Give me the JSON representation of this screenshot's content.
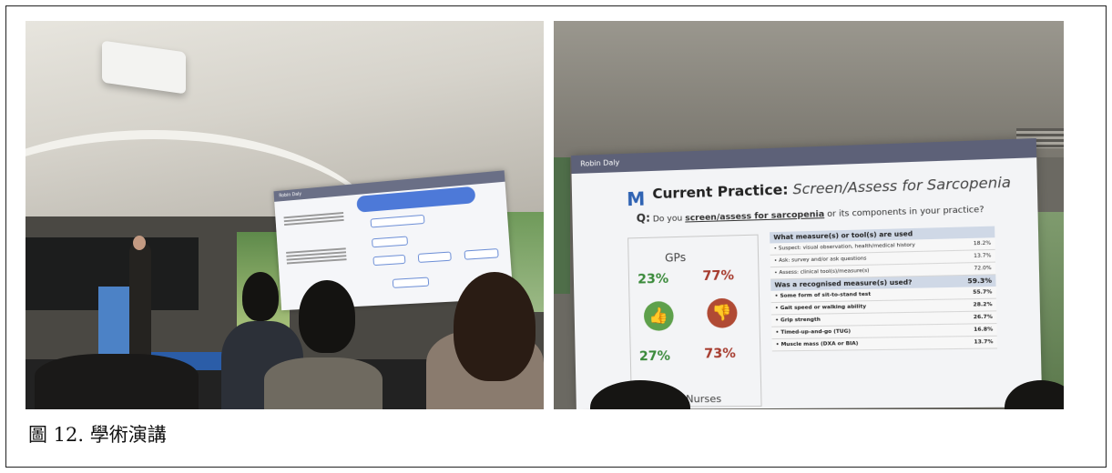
{
  "photo1": {
    "slide_author": "Robin Daly"
  },
  "photo2": {
    "slide": {
      "author": "Robin Daly",
      "logo_letter": "M",
      "title_bold": "Current Practice:",
      "title_italic": "Screen/Assess for Sarcopenia",
      "question_prefix": "Q:",
      "question_start": "Do you",
      "question_underlined": "screen/assess for sarcopenia",
      "question_end": "or its components in your practice?",
      "group_top": "GPs",
      "group_top_yes": "23%",
      "group_top_no": "77%",
      "group_bottom_yes": "27%",
      "group_bottom_no": "73%",
      "group_bottom": "Practice Nurses",
      "table": {
        "section1_header": "What measure(s) or tool(s) are used",
        "section1_rows": [
          {
            "label": "Suspect: visual observation, health/medical history",
            "value": "18.2%"
          },
          {
            "label": "Ask: survey and/or ask questions",
            "value": "13.7%"
          },
          {
            "label": "Assess: clinical tool(s)/measure(s)",
            "value": "72.0%"
          }
        ],
        "section2_header": "Was a recognised measure(s) used?",
        "section2_value": "59.3%",
        "section2_rows": [
          {
            "label": "Some form of sit-to-stand test",
            "value": "55.7%"
          },
          {
            "label": "Gait speed or walking ability",
            "value": "28.2%"
          },
          {
            "label": "Grip strength",
            "value": "26.7%"
          },
          {
            "label": "Timed-up-and-go (TUG)",
            "value": "16.8%"
          },
          {
            "label": "Muscle mass (DXA or BIA)",
            "value": "13.7%"
          }
        ]
      }
    }
  },
  "caption": "圖 12. 學術演講"
}
